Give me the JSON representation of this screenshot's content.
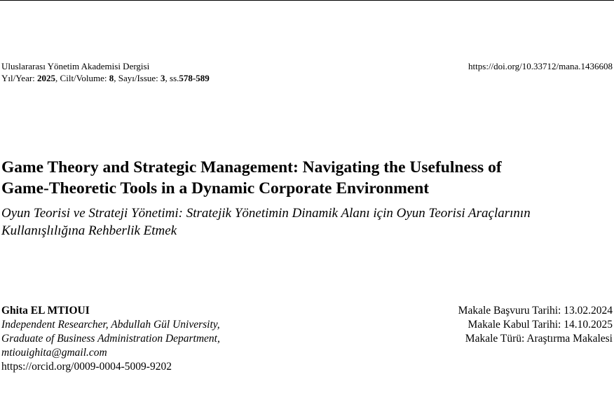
{
  "journal": {
    "name": "Uluslararası Yönetim Akademisi Dergisi",
    "year_label": "Yıl/Year: ",
    "year": "2025",
    "volume_label": ", Cilt/Volume: ",
    "volume": "8",
    "issue_label": ", Sayı/Issue: ",
    "issue": "3",
    "pages_label": ", ss.",
    "pages": "578-589",
    "doi": "https://doi.org/10.33712/mana.1436608"
  },
  "title_en_line1": "Game Theory and Strategic Management: Navigating the Usefulness of",
  "title_en_line2": "Game-Theoretic Tools in a Dynamic Corporate Environment",
  "title_tr_line1": "Oyun Teorisi ve Strateji Yönetimi: Stratejik Yönetimin Dinamik Alanı için Oyun Teorisi Araçlarının",
  "title_tr_line2": "Kullanışlılığına Rehberlik Etmek",
  "author": {
    "name": "Ghita EL MTIOUI",
    "affiliation_line1": "Independent Researcher, Abdullah Gül University,",
    "affiliation_line2": "Graduate of Business Administration Department,",
    "email": "mtiouighita@gmail.com",
    "orcid": "https://orcid.org/0009-0004-5009-9202"
  },
  "article_meta": {
    "submission": "Makale Başvuru Tarihi: 13.02.2024",
    "acceptance": "Makale Kabul Tarihi: 14.10.2025",
    "type": "Makale Türü: Araştırma Makalesi"
  }
}
